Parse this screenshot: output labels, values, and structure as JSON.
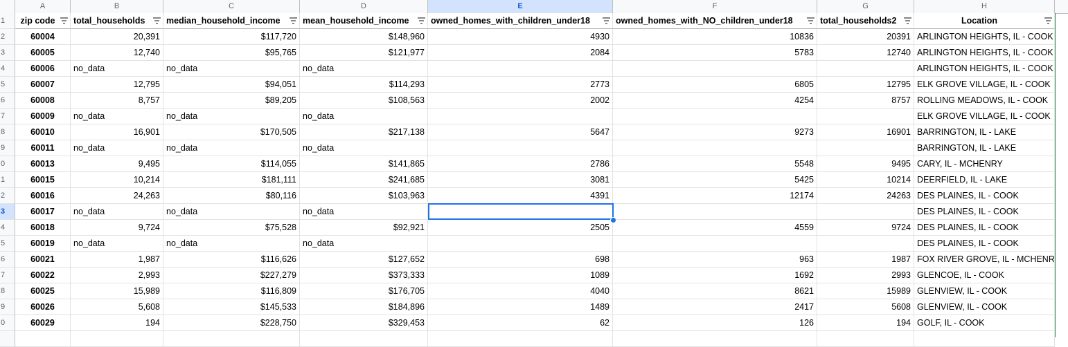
{
  "column_letters": [
    "A",
    "B",
    "C",
    "D",
    "E",
    "F",
    "G",
    "H"
  ],
  "selected_column": "E",
  "header_row_number": "1",
  "headers": [
    "zip code",
    "total_households",
    "median_household_income",
    "mean_household_income",
    "owned_homes_with_children_under18",
    "owned_homes_with_NO_children_under18",
    "total_households2",
    "Location"
  ],
  "row_labels": [
    "2",
    "3",
    "4",
    "5",
    "6",
    "7",
    "8",
    "9",
    "0",
    "1",
    "2",
    "3",
    "4",
    "5",
    "6",
    "7",
    "8",
    "9",
    "0"
  ],
  "selected_row_label": "3",
  "rows": [
    [
      "60004",
      "20,391",
      "$117,720",
      "$148,960",
      "4930",
      "10836",
      "20391",
      "ARLINGTON HEIGHTS, IL - COOK"
    ],
    [
      "60005",
      "12,740",
      "$95,765",
      "$121,977",
      "2084",
      "5783",
      "12740",
      "ARLINGTON HEIGHTS, IL - COOK"
    ],
    [
      "60006",
      "no_data",
      "no_data",
      "no_data",
      "",
      "",
      "",
      "ARLINGTON HEIGHTS, IL - COOK"
    ],
    [
      "60007",
      "12,795",
      "$94,051",
      "$114,293",
      "2773",
      "6805",
      "12795",
      "ELK GROVE VILLAGE, IL - COOK"
    ],
    [
      "60008",
      "8,757",
      "$89,205",
      "$108,563",
      "2002",
      "4254",
      "8757",
      "ROLLING MEADOWS, IL - COOK"
    ],
    [
      "60009",
      "no_data",
      "no_data",
      "no_data",
      "",
      "",
      "",
      "ELK GROVE VILLAGE, IL - COOK"
    ],
    [
      "60010",
      "16,901",
      "$170,505",
      "$217,138",
      "5647",
      "9273",
      "16901",
      "BARRINGTON, IL - LAKE"
    ],
    [
      "60011",
      "no_data",
      "no_data",
      "no_data",
      "",
      "",
      "",
      "BARRINGTON, IL - LAKE"
    ],
    [
      "60013",
      "9,495",
      "$114,055",
      "$141,865",
      "2786",
      "5548",
      "9495",
      "CARY, IL - MCHENRY"
    ],
    [
      "60015",
      "10,214",
      "$181,111",
      "$241,685",
      "3081",
      "5425",
      "10214",
      "DEERFIELD, IL - LAKE"
    ],
    [
      "60016",
      "24,263",
      "$80,116",
      "$103,963",
      "4391",
      "12174",
      "24263",
      "DES PLAINES, IL - COOK"
    ],
    [
      "60017",
      "no_data",
      "no_data",
      "no_data",
      "",
      "",
      "",
      "DES PLAINES, IL - COOK"
    ],
    [
      "60018",
      "9,724",
      "$75,528",
      "$92,921",
      "2505",
      "4559",
      "9724",
      "DES PLAINES, IL - COOK"
    ],
    [
      "60019",
      "no_data",
      "no_data",
      "no_data",
      "",
      "",
      "",
      "DES PLAINES, IL - COOK"
    ],
    [
      "60021",
      "1,987",
      "$116,626",
      "$127,652",
      "698",
      "963",
      "1987",
      "FOX RIVER GROVE, IL - MCHENRY"
    ],
    [
      "60022",
      "2,993",
      "$227,279",
      "$373,333",
      "1089",
      "1692",
      "2993",
      "GLENCOE, IL - COOK"
    ],
    [
      "60025",
      "15,989",
      "$116,809",
      "$176,705",
      "4040",
      "8621",
      "15989",
      "GLENVIEW, IL - COOK"
    ],
    [
      "60026",
      "5,608",
      "$145,533",
      "$184,896",
      "1489",
      "2417",
      "5608",
      "GLENVIEW, IL - COOK"
    ],
    [
      "60029",
      "194",
      "$228,750",
      "$329,453",
      "62",
      "126",
      "194",
      "GOLF, IL - COOK"
    ]
  ],
  "colors": {
    "selection": "#1a73e8",
    "selected_header_bg": "#d3e3fd"
  }
}
